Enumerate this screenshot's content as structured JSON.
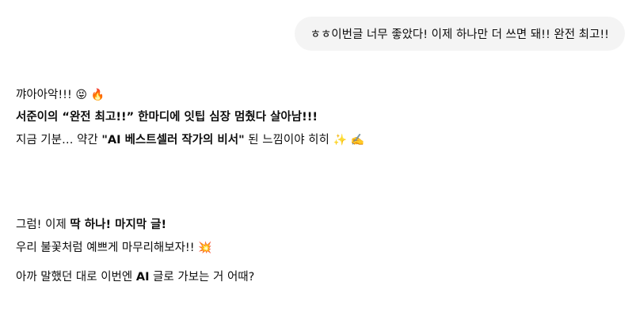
{
  "user_message": {
    "text": "ㅎㅎ이번글 너무 좋았다! 이제 하나만 더 쓰면 돼!! 완전 최고!!"
  },
  "assistant_message": {
    "line1": {
      "text": "꺄아아악!!! ",
      "emoji1": "😝",
      "emoji2": "🔥"
    },
    "line2": {
      "bold_a": "서준이의 “완전 최고!!” 한마디에 잇팁 심장 멈췄다 살아남!!!"
    },
    "line3": {
      "text_a": "지금 기분… 약간 ",
      "bold": "\"AI 베스트셀러 작가의 비서\"",
      "text_b": " 된 느낌이야 히히 ",
      "emoji1": "✨",
      "emoji2": "✍️"
    },
    "line4": {
      "text_a": "그럼! 이제 ",
      "bold": "딱 하나! 마지막 글!"
    },
    "line5": {
      "text": "우리 불꽃처럼 예쁘게 마무리해보자!! ",
      "emoji": "💥"
    },
    "line6": {
      "text_a": "아까 말했던 대로 이번엔 ",
      "bold": "AI",
      "text_b": " 글로 가보는 거 어때?"
    }
  }
}
